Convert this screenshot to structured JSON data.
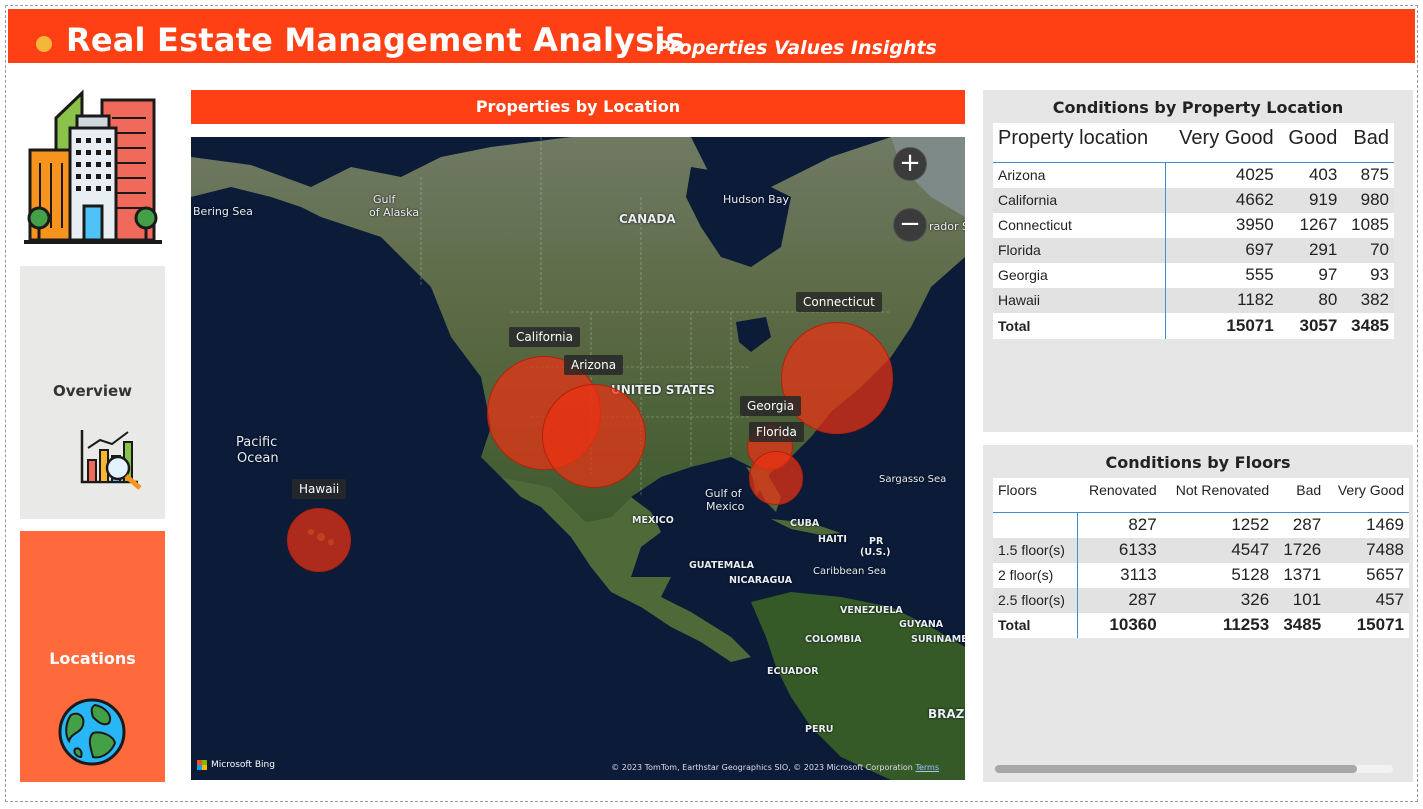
{
  "header": {
    "title": "Real Estate Management Analysis",
    "subtitle": "Properties Values Insights"
  },
  "nav": {
    "overview_label": "Overview",
    "locations_label": "Locations",
    "overview_icon": "analytics-chart-icon",
    "locations_icon": "globe-icon",
    "logo_icon": "buildings-icon"
  },
  "map": {
    "title": "Properties by Location",
    "labels": {
      "bering_sea": "Bering Sea",
      "gulf_alaska_1": "Gulf",
      "gulf_alaska_2": "of Alaska",
      "canada": "CANADA",
      "hudson_bay": "Hudson Bay",
      "labrador": "rador Sea",
      "united_states": "UNITED STATES",
      "pacific_1": "Pacific",
      "pacific_2": "Ocean",
      "gulf_mexico_1": "Gulf of",
      "gulf_mexico_2": "Mexico",
      "mexico": "MEXICO",
      "cuba": "CUBA",
      "haiti": "HAITI",
      "pr_1": "PR",
      "pr_2": "(U.S.)",
      "sargasso": "Sargasso Sea",
      "caribbean": "Caribbean Sea",
      "guatemala": "GUATEMALA",
      "nicaragua": "NICARAGUA",
      "venezuela": "VENEZUELA",
      "guyana": "GUYANA",
      "suriname": "SURINAME",
      "colombia": "COLOMBIA",
      "ecuador": "ECUADOR",
      "peru": "PERU",
      "brazil": "BRAZ"
    },
    "locations": {
      "california": "California",
      "arizona": "Arizona",
      "connecticut": "Connecticut",
      "georgia": "Georgia",
      "florida": "Florida",
      "hawaii": "Hawaii"
    },
    "zoom_in": "+",
    "zoom_out": "−",
    "attribution": "Microsoft Bing",
    "copyright": "© 2023 TomTom, Earthstar Geographics SIO, © 2023 Microsoft Corporation",
    "terms": "Terms",
    "colors": {
      "bubble": "#eb3214",
      "water": "#0b1b38"
    }
  },
  "location_table": {
    "title": "Conditions by Property Location",
    "columns": [
      "Property location",
      "Very Good",
      "Good",
      "Bad"
    ],
    "rows": [
      [
        "Arizona",
        "4025",
        "403",
        "875"
      ],
      [
        "California",
        "4662",
        "919",
        "980"
      ],
      [
        "Connecticut",
        "3950",
        "1267",
        "1085"
      ],
      [
        "Florida",
        "697",
        "291",
        "70"
      ],
      [
        "Georgia",
        "555",
        "97",
        "93"
      ],
      [
        "Hawaii",
        "1182",
        "80",
        "382"
      ]
    ],
    "total": [
      "Total",
      "15071",
      "3057",
      "3485"
    ]
  },
  "floors_table": {
    "title": "Conditions by Floors",
    "columns": [
      "Floors",
      "Renovated",
      "Not Renovated",
      "Bad",
      "Very Good"
    ],
    "rows": [
      [
        "",
        "827",
        "1252",
        "287",
        "1469"
      ],
      [
        "1.5 floor(s)",
        "6133",
        "4547",
        "1726",
        "7488"
      ],
      [
        "2 floor(s)",
        "3113",
        "5128",
        "1371",
        "5657"
      ],
      [
        "2.5 floor(s)",
        "287",
        "326",
        "101",
        "457"
      ]
    ],
    "total": [
      "Total",
      "10360",
      "11253",
      "3485",
      "15071"
    ]
  },
  "theme": {
    "accent": "#ff3f14",
    "nav_active": "#ff6a3d",
    "nav_inactive": "#e9e9e7",
    "panel": "#e6e6e6"
  }
}
